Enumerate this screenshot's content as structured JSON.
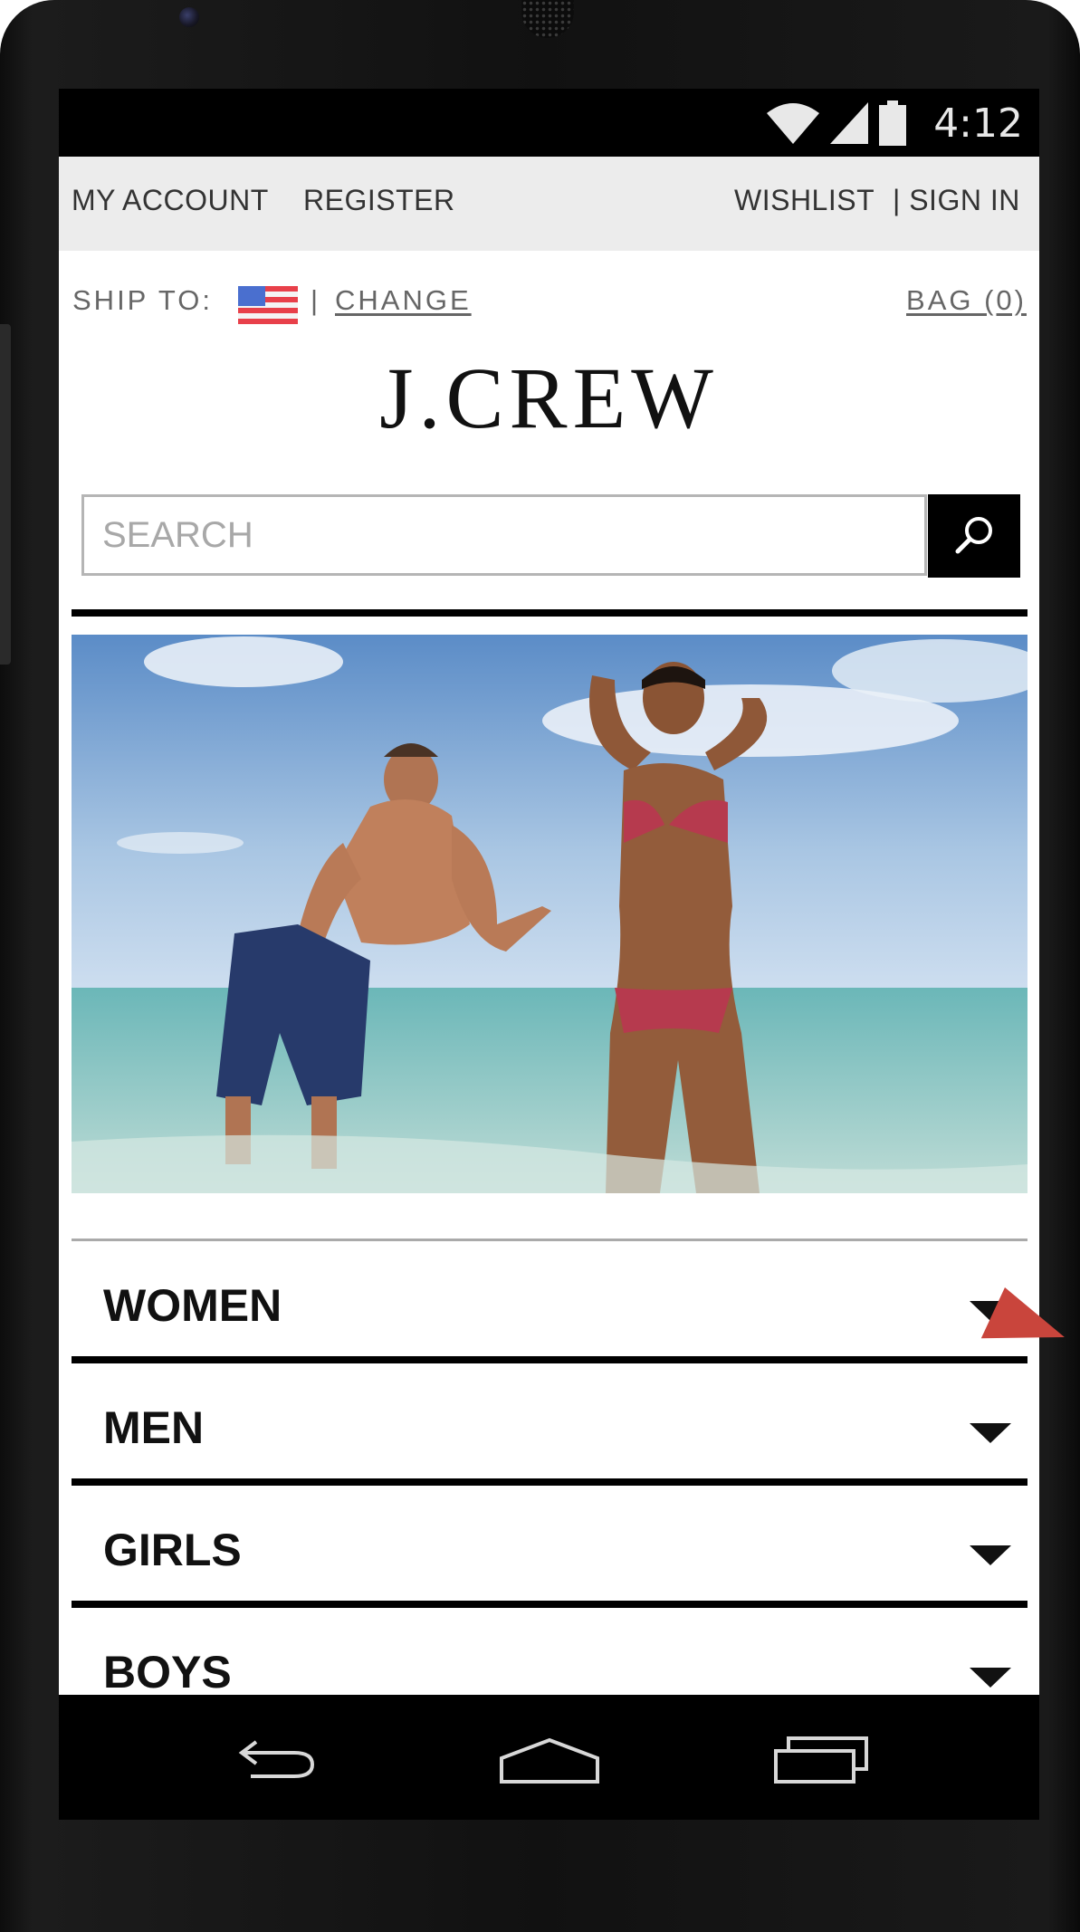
{
  "status_bar": {
    "time": "4:12",
    "icons": [
      "wifi-icon",
      "signal-icon",
      "battery-icon"
    ]
  },
  "top_nav": {
    "my_account": "MY ACCOUNT",
    "register": "REGISTER",
    "wishlist": "WISHLIST",
    "sign_in": "| SIGN IN"
  },
  "ship": {
    "label": "SHIP TO:",
    "flag": "us-flag-icon",
    "separator": "|",
    "change": "CHANGE",
    "bag": "BAG (0)"
  },
  "brand": {
    "logo": "J.CREW"
  },
  "search": {
    "placeholder": "SEARCH",
    "button_icon": "search-icon"
  },
  "hero": {
    "image": "beach-couple-photo"
  },
  "categories": [
    {
      "label": "WOMEN"
    },
    {
      "label": "MEN"
    },
    {
      "label": "GIRLS"
    },
    {
      "label": "BOYS"
    }
  ],
  "system_nav": [
    "back-icon",
    "home-icon",
    "recents-icon"
  ],
  "colors": {
    "accent_annotation": "#c9453c",
    "background_bar": "#ececec",
    "text_dark": "#111111"
  }
}
